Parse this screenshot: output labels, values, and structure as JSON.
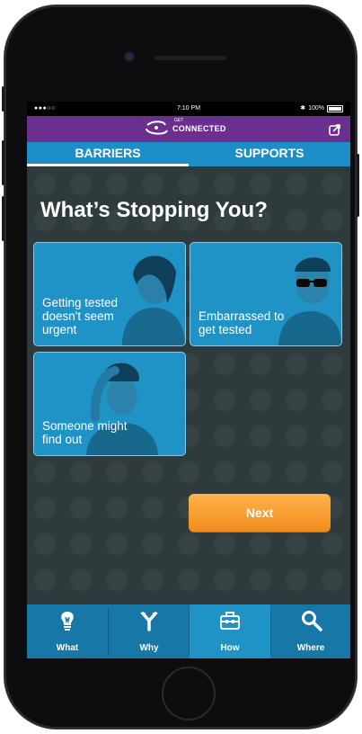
{
  "status_bar": {
    "signal": "●●●○○",
    "time": "7:10 PM",
    "bt": "✱",
    "battery": "100%"
  },
  "app_bar": {
    "logo_small": "GET",
    "logo_text": "CONNECTED"
  },
  "tabs": [
    {
      "label": "BARRIERS",
      "active": true
    },
    {
      "label": "SUPPORTS",
      "active": false
    }
  ],
  "main": {
    "heading": "What’s Stopping You?",
    "cards": [
      {
        "label": "Getting tested\ndoesn't seem\nurgent"
      },
      {
        "label": "Embarrassed to\nget tested"
      },
      {
        "label": "Someone might\nfind out"
      }
    ],
    "next_label": "Next"
  },
  "bottom_nav": [
    {
      "label": "What",
      "icon": "lightbulb-icon",
      "active": false
    },
    {
      "label": "Why",
      "icon": "branch-icon",
      "active": false
    },
    {
      "label": "How",
      "icon": "toolbox-icon",
      "active": true
    },
    {
      "label": "Where",
      "icon": "search-icon",
      "active": false
    }
  ],
  "colors": {
    "purple": "#6b2f8f",
    "blue": "#1c8fc9",
    "orange": "#f28c1d",
    "bg": "#2f3a3d"
  }
}
